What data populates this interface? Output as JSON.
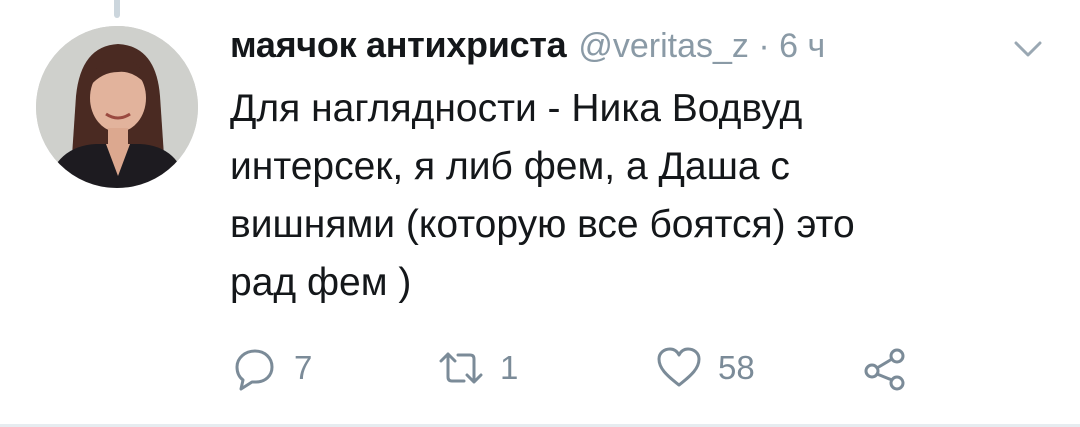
{
  "tweet": {
    "author_name": "маячок антихриста",
    "meta": "@veritas_z · 6 ч",
    "text": "Для наглядности - Ника Водвуд\nинтерсек, я либ фем, а Даша с\nвишнями (которую все боятся) это\nрад фем )"
  },
  "actions": {
    "reply": {
      "icon": "reply-bubble-icon",
      "count": "7"
    },
    "retweet": {
      "icon": "retweet-icon",
      "count": "1"
    },
    "like": {
      "icon": "heart-icon",
      "count": "58"
    },
    "share": {
      "icon": "share-icon"
    }
  },
  "menu": {
    "icon": "chevron-down-icon"
  },
  "colors": {
    "text": "#14171a",
    "secondary": "#8a9aa6",
    "icon": "#7b8b98",
    "divider": "#e6ecf0",
    "thread_line": "#ccd6dd"
  }
}
